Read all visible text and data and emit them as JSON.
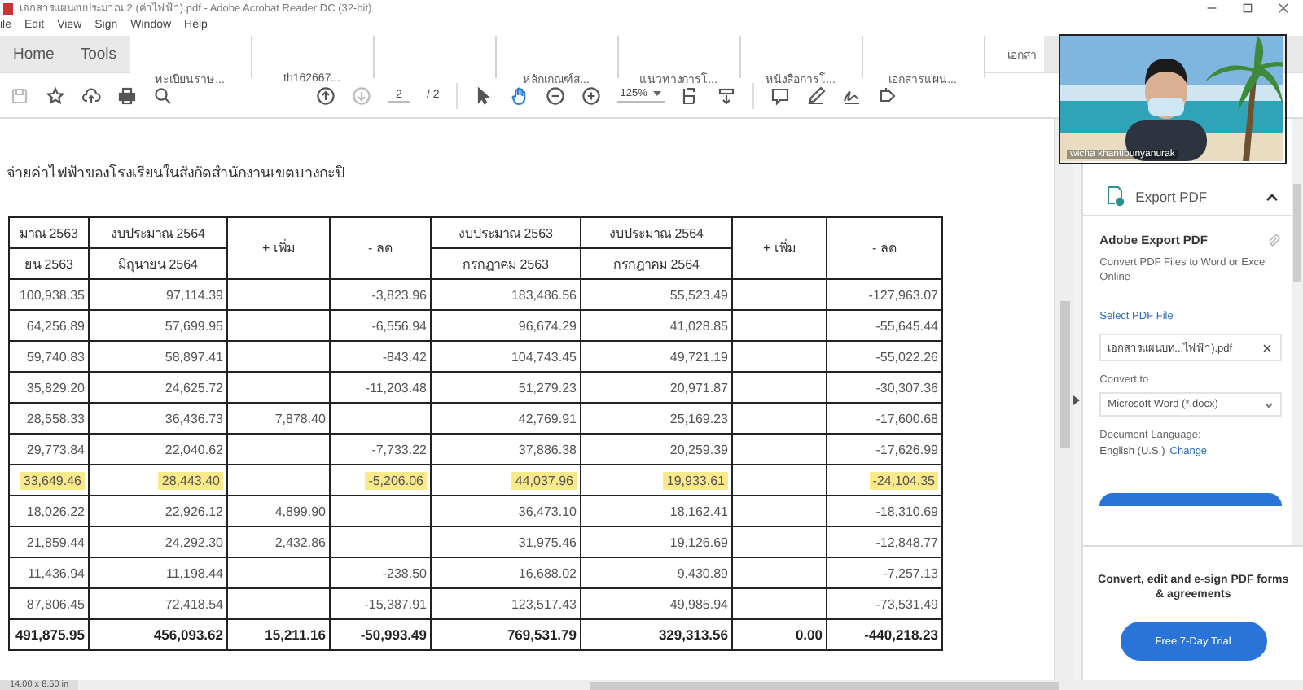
{
  "window": {
    "title": "เอกสารแผนงบประมาณ 2 (ค่าไฟฟ้า).pdf - Adobe Acrobat Reader DC (32-bit)"
  },
  "menu": [
    "ile",
    "Edit",
    "View",
    "Sign",
    "Window",
    "Help"
  ],
  "tabs": [
    {
      "label": "Home",
      "kind": "nav",
      "selected": false
    },
    {
      "label": "Tools",
      "kind": "nav",
      "selected": false
    },
    {
      "label": "ทะเบียนราษ...",
      "kind": "doc",
      "selected": false
    },
    {
      "label": "th162667...",
      "kind": "doc",
      "selected": false
    },
    {
      "kind": "doc",
      "selected": false
    },
    {
      "label": "หลักเกณฑ์ส...",
      "kind": "doc",
      "selected": false
    },
    {
      "label": "แนวทางการโ...",
      "kind": "doc",
      "selected": false
    },
    {
      "label": "หนังสือการโ...",
      "kind": "doc",
      "selected": false
    },
    {
      "label": "เอกสารแผน...",
      "kind": "doc",
      "selected": false
    },
    {
      "label": "เอกสา",
      "kind": "doc",
      "selected": true
    }
  ],
  "toolbar": {
    "page": "2",
    "page_total": "/ 2",
    "zoom": "125%",
    "hand_selected": true,
    "next_page_disabled": true
  },
  "document": {
    "title": "จ่ายค่าไฟฟ้าของโรงเรียนในสังกัดสำนักงานเขตบางกะปิ",
    "columns": [
      {
        "heading": "มาณ 2563",
        "subheading": "ยน 2563"
      },
      {
        "heading": "งบประมาณ 2564",
        "subheading": "มิถุนายน 2564"
      },
      {
        "heading": "+ เพิ่ม"
      },
      {
        "heading": "- ลด"
      },
      {
        "heading": "งบประมาณ 2563",
        "subheading": "กรกฎาคม 2563"
      },
      {
        "heading": "งบประมาณ 2564",
        "subheading": "กรกฎาคม 2564"
      },
      {
        "heading": "+ เพิ่ม"
      },
      {
        "heading": "- ลด"
      }
    ],
    "rows": [
      {
        "highlighted": false,
        "cells": [
          "100,938.35",
          "97,114.39",
          null,
          "-3,823.96",
          "183,486.56",
          "55,523.49",
          null,
          "-127,963.07"
        ]
      },
      {
        "highlighted": false,
        "cells": [
          "64,256.89",
          "57,699.95",
          null,
          "-6,556.94",
          "96,674.29",
          "41,028.85",
          null,
          "-55,645.44"
        ]
      },
      {
        "highlighted": false,
        "cells": [
          "59,740.83",
          "58,897.41",
          null,
          "-843.42",
          "104,743.45",
          "49,721.19",
          null,
          "-55,022.26"
        ]
      },
      {
        "highlighted": false,
        "cells": [
          "35,829.20",
          "24,625.72",
          null,
          "-11,203.48",
          "51,279.23",
          "20,971.87",
          null,
          "-30,307.36"
        ]
      },
      {
        "highlighted": false,
        "cells": [
          "28,558.33",
          "36,436.73",
          "7,878.40",
          null,
          "42,769.91",
          "25,169.23",
          null,
          "-17,600.68"
        ]
      },
      {
        "highlighted": false,
        "cells": [
          "29,773.84",
          "22,040.62",
          null,
          "-7,733.22",
          "37,886.38",
          "20,259.39",
          null,
          "-17,626.99"
        ]
      },
      {
        "highlighted": true,
        "cells": [
          "33,649.46",
          "28,443.40",
          null,
          "-5,206.06",
          "44,037.96",
          "19,933.61",
          null,
          "-24,104.35"
        ]
      },
      {
        "highlighted": false,
        "cells": [
          "18,026.22",
          "22,926.12",
          "4,899.90",
          null,
          "36,473.10",
          "18,162.41",
          null,
          "-18,310.69"
        ]
      },
      {
        "highlighted": false,
        "cells": [
          "21,859.44",
          "24,292.30",
          "2,432.86",
          null,
          "31,975.46",
          "19,126.69",
          null,
          "-12,848.77"
        ]
      },
      {
        "highlighted": false,
        "cells": [
          "11,436.94",
          "11,198.44",
          null,
          "-238.50",
          "16,688.02",
          "9,430.89",
          null,
          "-7,257.13"
        ]
      },
      {
        "highlighted": false,
        "cells": [
          "87,806.45",
          "72,418.54",
          null,
          "-15,387.91",
          "123,517.43",
          "49,985.94",
          null,
          "-73,531.49"
        ]
      }
    ],
    "total": [
      "491,875.95",
      "456,093.62",
      "15,211.16",
      "-50,993.49",
      "769,531.79",
      "329,313.56",
      "0.00",
      "-440,218.23"
    ]
  },
  "panel": {
    "header": "Export PDF",
    "expanded": true,
    "title": "Adobe Export PDF",
    "description": "Convert PDF Files to Word or Excel Online",
    "select_link": "Select PDF File",
    "file": "เอกสารแผนบท...ไฟฟ้า).pdf",
    "convert_label": "Convert to",
    "convert_value": "Microsoft Word (*.docx)",
    "language_label": "Document Language:",
    "language_value": "English (U.S.)",
    "change_link": "Change",
    "promo": "Convert, edit and e-sign PDF forms & agreements",
    "trial_button": "Free 7-Day Trial"
  },
  "status_bar": {
    "page_size": "14.00 x 8.50 in"
  },
  "video": {
    "kind": "picture",
    "name": "wicha khantibunyanurak"
  }
}
